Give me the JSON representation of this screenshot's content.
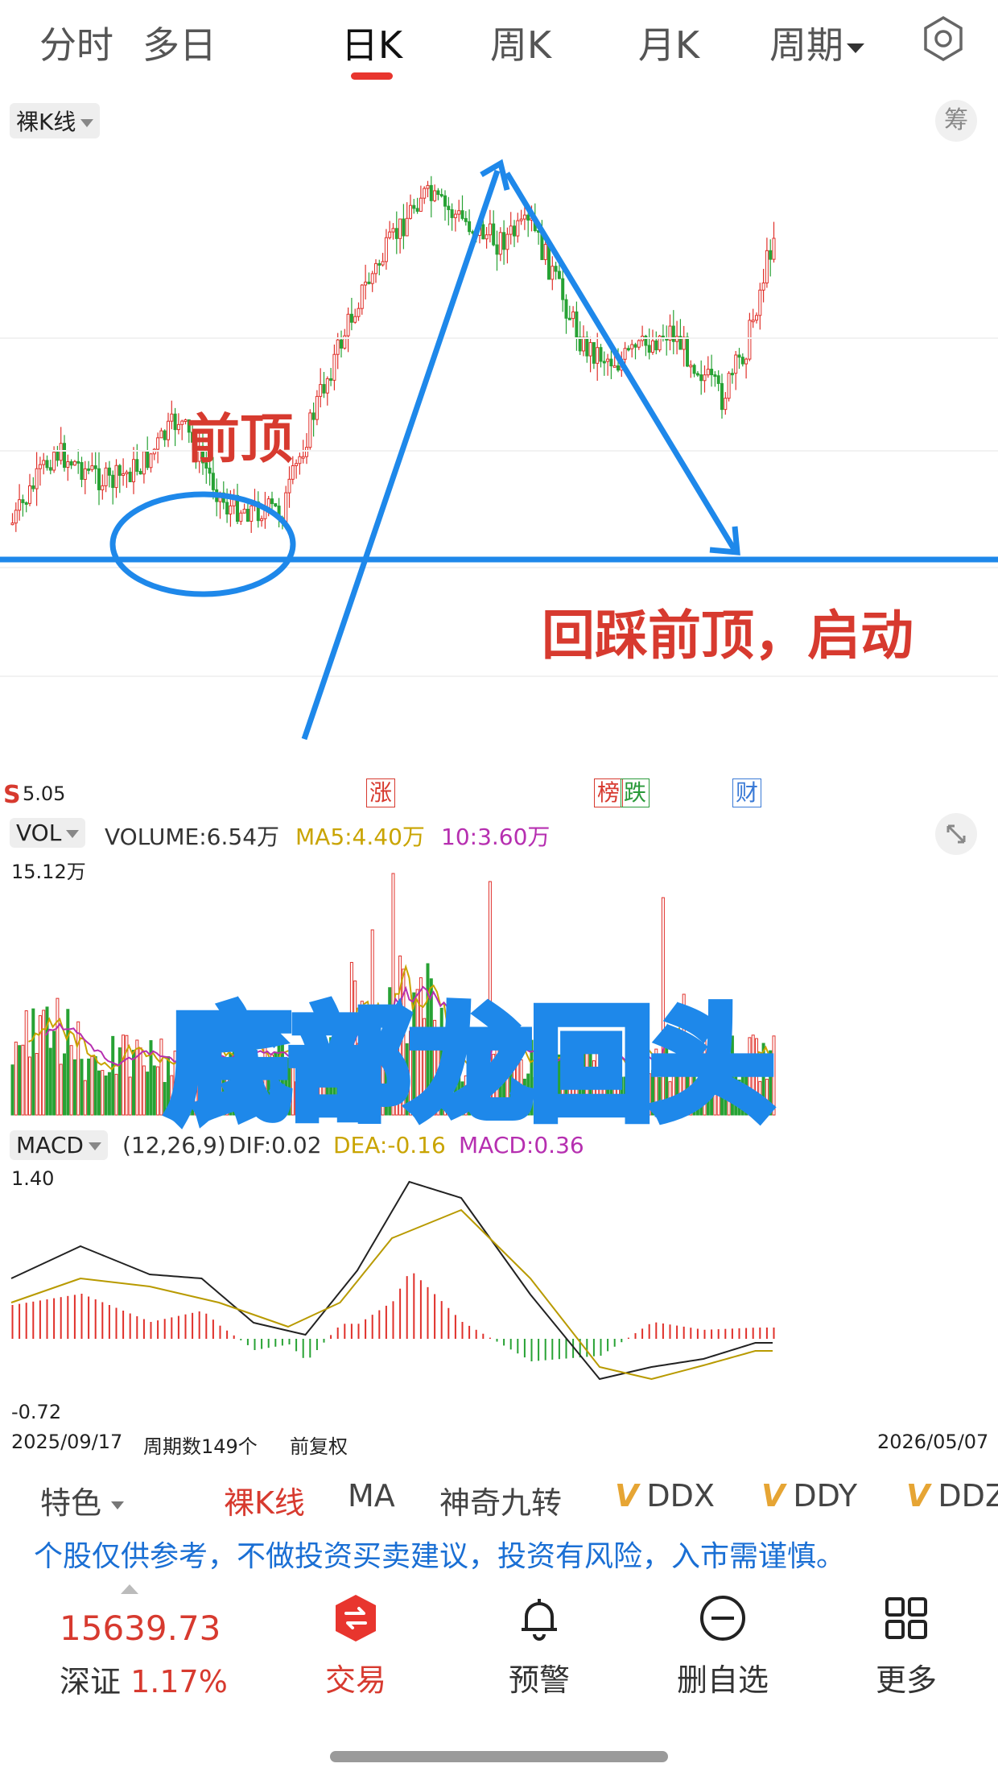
{
  "tabs": [
    {
      "label": "分时"
    },
    {
      "label": "多日"
    },
    {
      "label": "日K"
    },
    {
      "label": "周K"
    },
    {
      "label": "月K"
    },
    {
      "label": "周期"
    }
  ],
  "kline": {
    "selector_label": "裸K线",
    "chip_button": "筹",
    "low_marker": "S",
    "low_value": "5.05",
    "events": [
      {
        "label": "涨",
        "color": "#d73a2f"
      },
      {
        "label": "榜",
        "color": "#d73a2f"
      },
      {
        "label": "跌",
        "color": "#2a9a3a"
      },
      {
        "label": "财",
        "color": "#3a7ad6"
      }
    ]
  },
  "annotations": {
    "previous_top": "前顶",
    "pullback_start": "回踩前顶，启动",
    "title": "底部龙回头",
    "line_color": "#1e88ea",
    "text_red": "#d73a2f"
  },
  "volume": {
    "selector_label": "VOL",
    "volume_value": "VOLUME:6.54万",
    "ma5_value": "MA5:4.40万",
    "ma10_value": "10:3.60万",
    "max_label": "15.12万",
    "ma5_color": "#c9a400",
    "ma10_color": "#b62fb0"
  },
  "macd": {
    "selector_label": "MACD",
    "params": "(12,26,9)",
    "dif": "DIF:0.02",
    "dea": "DEA:-0.16",
    "macd": "MACD:0.36",
    "max_label": "1.40",
    "min_label": "-0.72"
  },
  "axis": {
    "start_date": "2025/09/17",
    "period_count": "周期数149个",
    "adjust": "前复权",
    "end_date": "2026/05/07"
  },
  "indicator_bar": {
    "special": "特色",
    "items": [
      "裸K线",
      "MA",
      "神奇九转",
      "DDX",
      "DDY",
      "DDZ"
    ],
    "active_color": "#d73a2f"
  },
  "disclaimer": "个股仅供参考，不做投资买卖建议，投资有风险，入市需谨慎。",
  "bottom_nav": {
    "index_value": "15639.73",
    "index_name": "深证",
    "index_change": "1.17%",
    "trade": "交易",
    "alert": "预警",
    "remove_watch": "删自选",
    "more": "更多"
  },
  "colors": {
    "up": "#e0302a",
    "down": "#27a234"
  }
}
